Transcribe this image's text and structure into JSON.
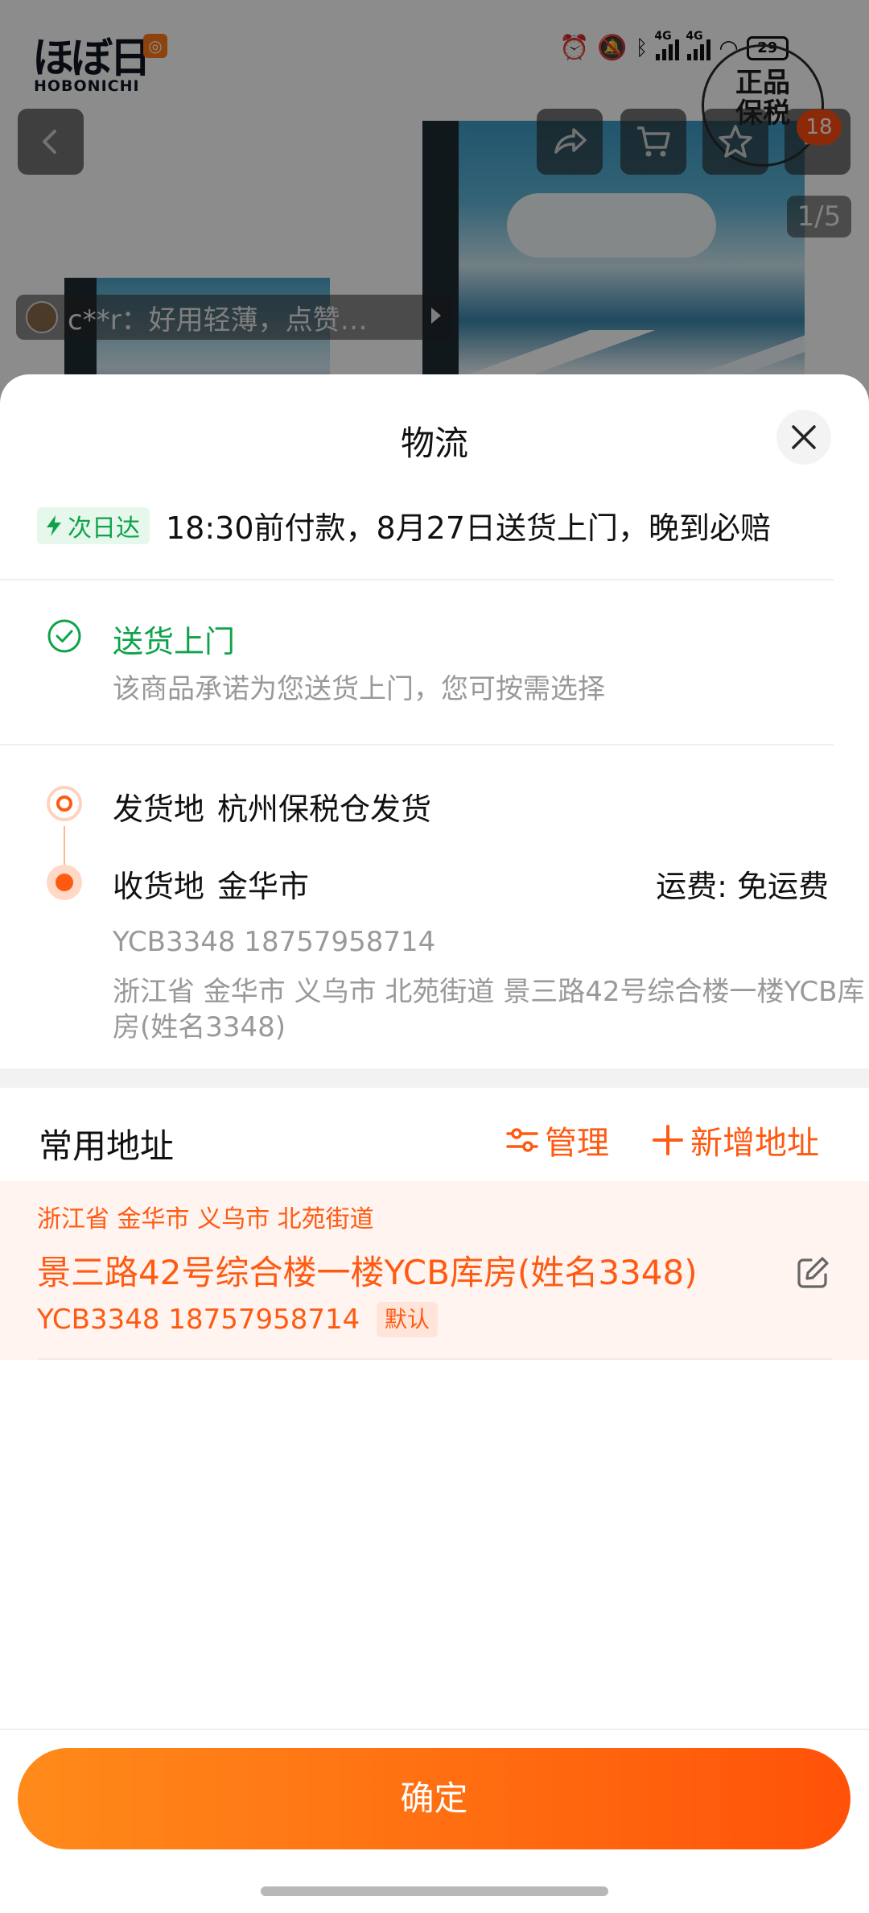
{
  "background": {
    "logo_text": "ほぼ日",
    "logo_sub": "HOBONICHI",
    "seal_line1": "正品",
    "seal_line2": "保税",
    "cart_badge": "18",
    "image_counter": "1/5",
    "review_snippet": "c**r：好用轻薄，点赞…",
    "status": {
      "network1": "4G",
      "network2": "4G",
      "battery": "29"
    }
  },
  "sheet": {
    "title": "物流",
    "promo": {
      "tag": "次日达",
      "text": "18:30前付款，8月27日送货上门，晚到必赔"
    },
    "delivery": {
      "title": "送货上门",
      "desc": "该商品承诺为您送货上门，您可按需选择"
    },
    "route": {
      "from_label": "发货地",
      "from_value": "杭州保税仓发货",
      "to_label": "收货地",
      "to_value": "金华市",
      "fee": "运费: 免运费",
      "contact": "YCB3348 18757958714",
      "address": "浙江省 金华市 义乌市 北苑街道 景三路42号综合楼一楼YCB库房(姓名3348)"
    },
    "common": {
      "title": "常用地址",
      "manage": "管理",
      "add": "新增地址",
      "selected": {
        "region": "浙江省 金华市 义乌市 北苑街道",
        "street": "景三路42号综合楼一楼YCB库房(姓名3348)",
        "phone": "YCB3348  18757958714",
        "tag": "默认"
      }
    },
    "confirm": "确定"
  },
  "colors": {
    "accent": "#ff5a12",
    "green": "#0ea34a",
    "muted": "#999999"
  }
}
